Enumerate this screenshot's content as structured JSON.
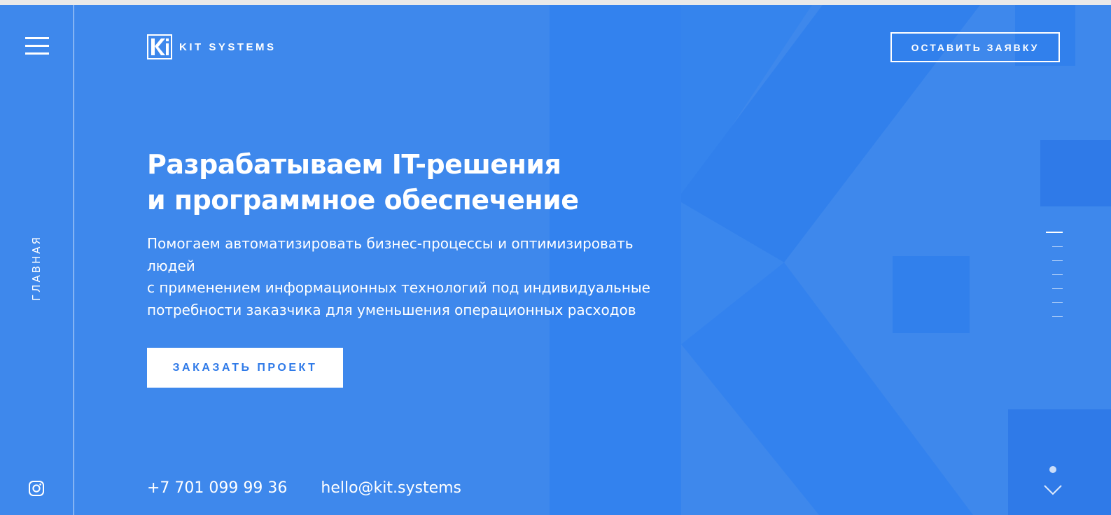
{
  "nav": {
    "section_label": "ГЛАВНАЯ"
  },
  "header": {
    "logo_text": "KIT SYSTEMS",
    "request_button": "ОСТАВИТЬ ЗАЯВКУ"
  },
  "hero": {
    "title_lines": [
      "Разрабатываем IT-решения",
      "и программное обеспечение"
    ],
    "subtitle_lines": [
      "Помогаем автоматизировать бизнес-процессы и оптимизировать",
      "людей",
      "с применением информационных технологий под индивидуальные",
      "потребности заказчика для уменьшения операционных расходов"
    ],
    "cta_button": "ЗАКАЗАТЬ ПРОЕКТ"
  },
  "contacts": {
    "phone": "+7 701 099 99 36",
    "email": "hello@kit.systems"
  },
  "pager": {
    "slides": 7,
    "active_index": 0
  },
  "colors": {
    "background": "#3e88ec",
    "shape": "#2f7ae8",
    "text": "#ffffff",
    "cta_text": "#2f7ae8"
  },
  "icons": [
    "menu-icon",
    "instagram-icon",
    "kit-logo-icon",
    "scroll-down-icon"
  ]
}
